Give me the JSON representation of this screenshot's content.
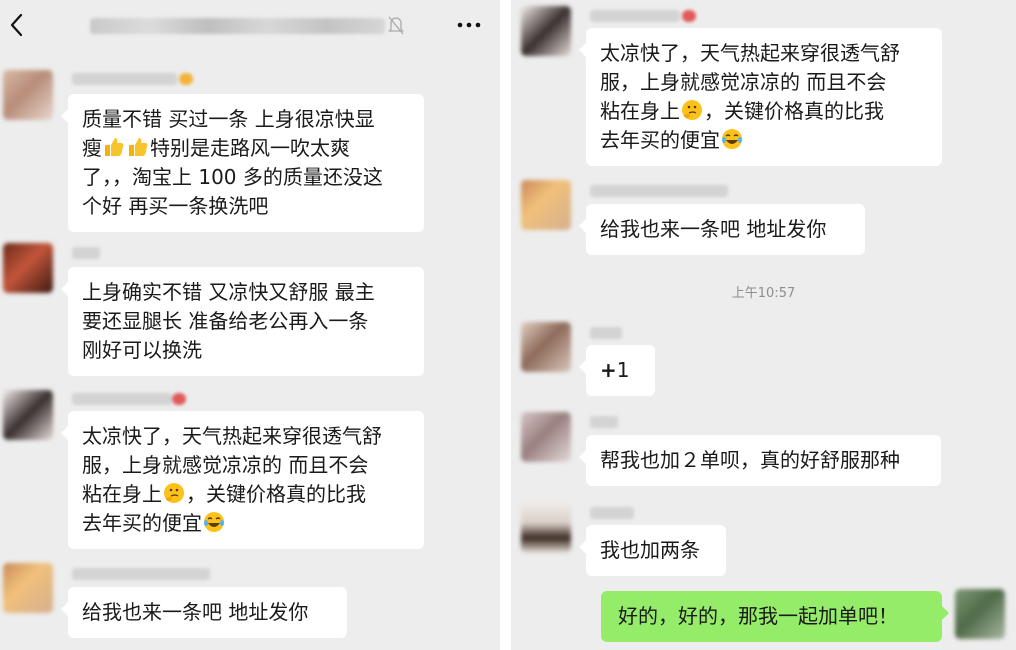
{
  "left": {
    "messages": [
      {
        "text": "质量不错 买过一条 上身很凉快显\n瘦",
        "text2": "特别是走路风一吹太爽\n了，，淘宝上 100 多的质量还没这\n个好  再买一条换洗吧"
      },
      {
        "text": "上身确实不错 又凉快又舒服 最主\n要还显腿长 准备给老公再入一条\n刚好可以换洗"
      },
      {
        "text": "太凉快了，天气热起来穿很透气舒\n服，上身就感觉凉凉的 而且不会\n粘在身上",
        "text2": "，关键价格真的比我\n去年买的便宜"
      },
      {
        "text": "给我也来一条吧 地址发你"
      }
    ]
  },
  "right": {
    "timestamp": "上午10:57",
    "messages": [
      {
        "text": "太凉快了，天气热起来穿很透气舒\n服，上身就感觉凉凉的 而且不会\n粘在身上",
        "text2": "，关键价格真的比我\n去年买的便宜"
      },
      {
        "text": "给我也来一条吧 地址发你"
      },
      {
        "plus": "+",
        "text": "1"
      },
      {
        "text": "帮我也加２单呗，真的好舒服那种"
      },
      {
        "text": "我也加两条"
      },
      {
        "text": "好的，好的，那我一起加单吧！"
      }
    ]
  },
  "icons": {
    "back": "chevron-left-icon",
    "mute": "bell-off-icon",
    "more": "more-horizontal-icon",
    "thumbs_up": "thumbs-up-emoji",
    "thinking": "thinking-face-emoji",
    "laughing": "tears-of-joy-emoji"
  },
  "colors": {
    "background": "#ededed",
    "bubble_incoming": "#ffffff",
    "bubble_outgoing": "#95ec69",
    "timestamp": "#8e8e8e"
  }
}
